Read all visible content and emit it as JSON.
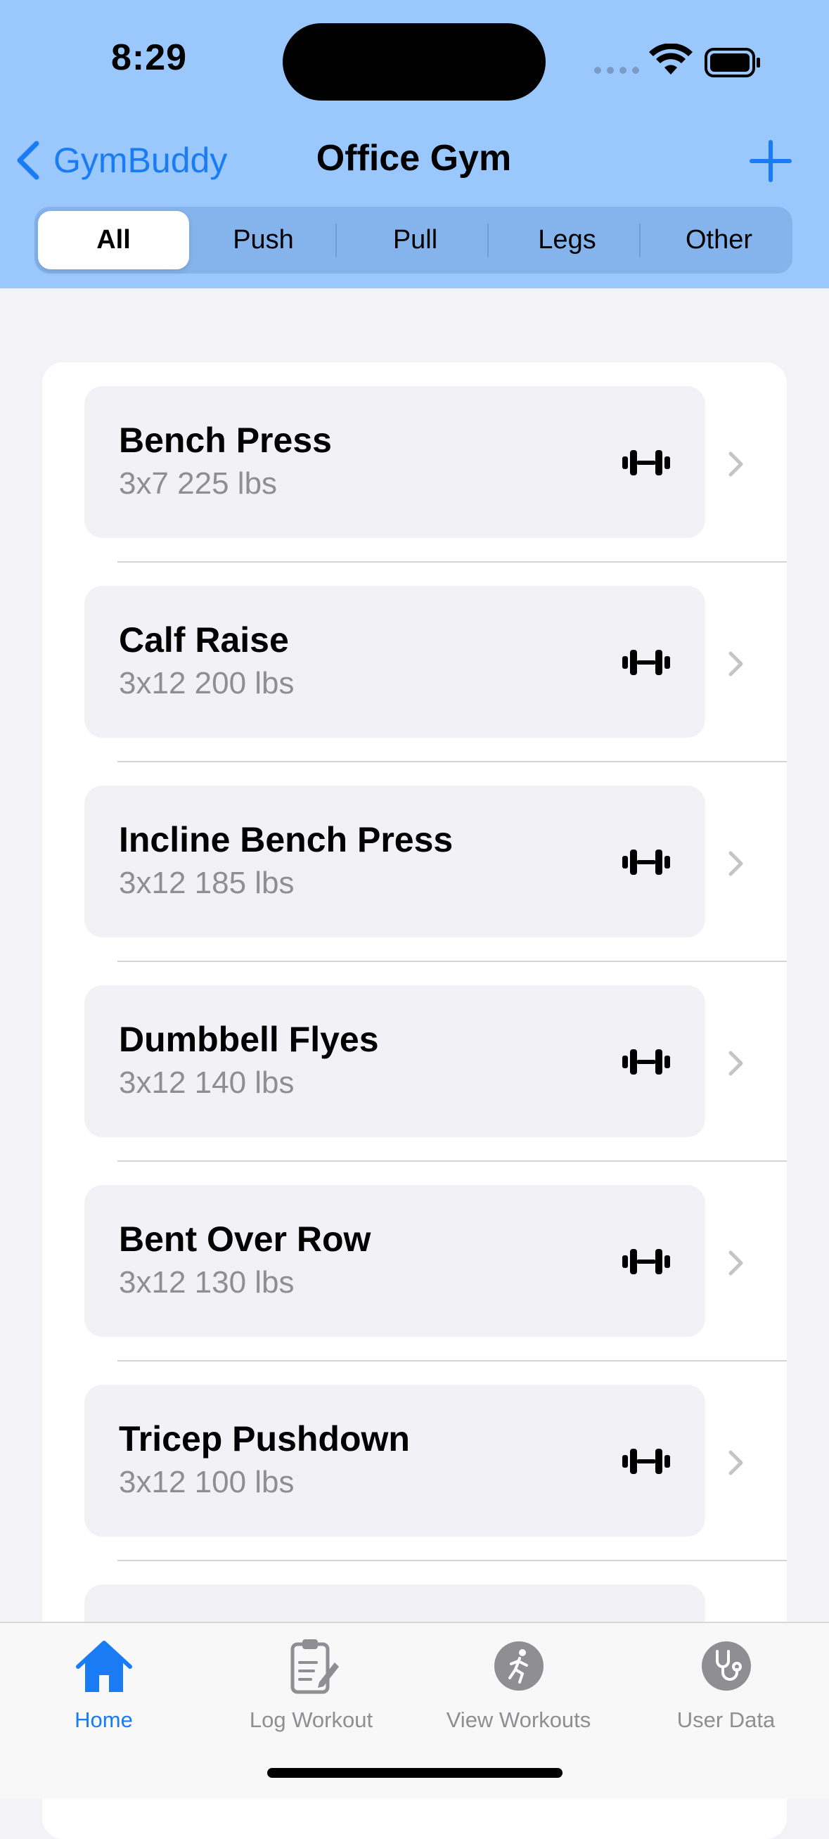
{
  "status_bar": {
    "time": "8:29"
  },
  "nav": {
    "back_label": "GymBuddy",
    "title": "Office Gym"
  },
  "segments": [
    {
      "label": "All",
      "selected": true
    },
    {
      "label": "Push",
      "selected": false
    },
    {
      "label": "Pull",
      "selected": false
    },
    {
      "label": "Legs",
      "selected": false
    },
    {
      "label": "Other",
      "selected": false
    }
  ],
  "exercises": [
    {
      "name": "Bench Press",
      "detail": "3x7 225 lbs",
      "icon": "dumbbell-icon"
    },
    {
      "name": "Calf Raise",
      "detail": "3x12 200 lbs",
      "icon": "dumbbell-icon"
    },
    {
      "name": "Incline Bench Press",
      "detail": "3x12 185 lbs",
      "icon": "dumbbell-icon"
    },
    {
      "name": "Dumbbell Flyes",
      "detail": "3x12 140 lbs",
      "icon": "dumbbell-icon"
    },
    {
      "name": "Bent Over Row",
      "detail": "3x12 130 lbs",
      "icon": "dumbbell-icon"
    },
    {
      "name": "Tricep Pushdown",
      "detail": "3x12 100 lbs",
      "icon": "dumbbell-icon"
    }
  ],
  "tabbar": {
    "tabs": [
      {
        "label": "Home",
        "icon": "house-icon",
        "active": true
      },
      {
        "label": "Log Workout",
        "icon": "clipboard-icon",
        "active": false
      },
      {
        "label": "View Workouts",
        "icon": "running-figure-icon",
        "active": false
      },
      {
        "label": "User Data",
        "icon": "stethoscope-icon",
        "active": false
      }
    ]
  },
  "colors": {
    "header_bg": "#9ac8fd",
    "accent": "#1a7cf5",
    "secondary_text": "#8e8e93"
  }
}
